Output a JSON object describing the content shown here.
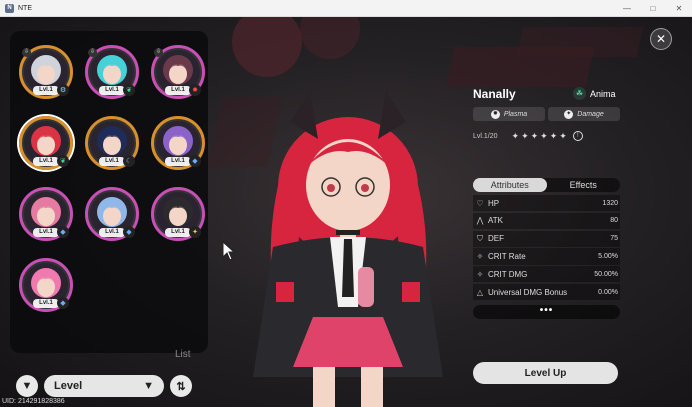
{
  "window": {
    "title": "NTE",
    "icon_label": "N"
  },
  "roster": {
    "list_label": "List",
    "characters": [
      {
        "level": "Lvl.1",
        "ring": "#d98f2c",
        "hair": "#cfd3dc",
        "elem_color": "#9ad6ff",
        "elem_icon": "gear-icon",
        "locked": true
      },
      {
        "level": "Lvl.1",
        "ring": "#c84fb5",
        "hair": "#46d1d6",
        "elem_color": "#3fd9a0",
        "elem_icon": "leaf-icon",
        "locked": true
      },
      {
        "level": "Lvl.1",
        "ring": "#c84fb5",
        "hair": "#6b3a4a",
        "elem_color": "#ff4a4a",
        "elem_icon": "flame-icon",
        "locked": true
      },
      {
        "level": "Lvl.1",
        "ring": "#d98f2c",
        "hair": "#d93344",
        "elem_color": "#3fd9a0",
        "elem_icon": "leaf-icon",
        "locked": false,
        "selected": true
      },
      {
        "level": "Lvl.1",
        "ring": "#d98f2c",
        "hair": "#1f2c57",
        "elem_color": "#6fa8ff",
        "elem_icon": "moon-icon",
        "locked": false
      },
      {
        "level": "Lvl.1",
        "ring": "#d98f2c",
        "hair": "#8b62c8",
        "elem_color": "#6fa8ff",
        "elem_icon": "droplet-icon",
        "locked": false
      },
      {
        "level": "Lvl.1",
        "ring": "#c84fb5",
        "hair": "#e57ba0",
        "elem_color": "#6fa8ff",
        "elem_icon": "droplet-icon",
        "locked": false
      },
      {
        "level": "Lvl.1",
        "ring": "#c84fb5",
        "hair": "#8fb7e8",
        "elem_color": "#6fa8ff",
        "elem_icon": "droplet-icon",
        "locked": false
      },
      {
        "level": "Lvl.1",
        "ring": "#c84fb5",
        "hair": "#2d2a2e",
        "elem_color": "#f5d04a",
        "elem_icon": "star-icon",
        "locked": false
      },
      {
        "level": "Lvl.1",
        "ring": "#c84fb5",
        "hair": "#f07ab0",
        "elem_color": "#6fa8ff",
        "elem_icon": "droplet-icon",
        "locked": false
      }
    ]
  },
  "controls": {
    "sort_label": "Level",
    "uid": "UID: 214291828386"
  },
  "info": {
    "name": "Nanally",
    "element": "Anima",
    "tags": [
      "Plasma",
      "Damage"
    ],
    "level_text": "Lvl.1/20",
    "stars": "✦✦✦✦✦✦",
    "tabs": [
      "Attributes",
      "Effects"
    ],
    "stats": [
      {
        "label": "HP",
        "value": "1320",
        "icon": "heart-icon"
      },
      {
        "label": "ATK",
        "value": "80",
        "icon": "atk-icon"
      },
      {
        "label": "DEF",
        "value": "75",
        "icon": "shield-icon"
      },
      {
        "label": "CRIT Rate",
        "value": "5.00%",
        "icon": "crit-rate-icon"
      },
      {
        "label": "CRIT DMG",
        "value": "50.00%",
        "icon": "crit-dmg-icon"
      },
      {
        "label": "Universal DMG Bonus",
        "value": "0.00%",
        "icon": "triangle-icon"
      }
    ],
    "more": "•••",
    "level_up": "Level Up"
  }
}
